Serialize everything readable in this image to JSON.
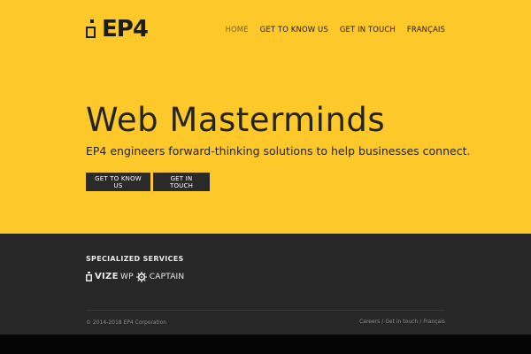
{
  "header": {
    "logo_text": "EP4",
    "nav": [
      {
        "label": "HOME",
        "active": true
      },
      {
        "label": "GET TO KNOW US",
        "active": false
      },
      {
        "label": "GET IN TOUCH",
        "active": false
      },
      {
        "label": "FRANÇAIS",
        "active": false
      }
    ]
  },
  "hero": {
    "title": "Web Masterminds",
    "subtitle": "EP4 engineers forward-thinking solutions to help businesses connect.",
    "buttons": [
      {
        "label": "GET TO KNOW US"
      },
      {
        "label": "GET IN TOUCH"
      }
    ]
  },
  "footer": {
    "section_title": "SPECIALIZED SERVICES",
    "partners": [
      {
        "name": "VIZE",
        "icon": "vize-logo-icon"
      },
      {
        "name_prefix": "WP",
        "name_suffix": "CAPTAIN",
        "icon": "ship-wheel-icon"
      }
    ],
    "copyright": "© 2014-2018 EP4 Corporation",
    "links": [
      "Careers",
      "Get in touch",
      "Français"
    ],
    "link_separator": "/"
  },
  "colors": {
    "brand_yellow": "#fdc829",
    "footer_bg": "#272727",
    "button_bg": "#2a2a2a",
    "text_dark": "#242424"
  }
}
